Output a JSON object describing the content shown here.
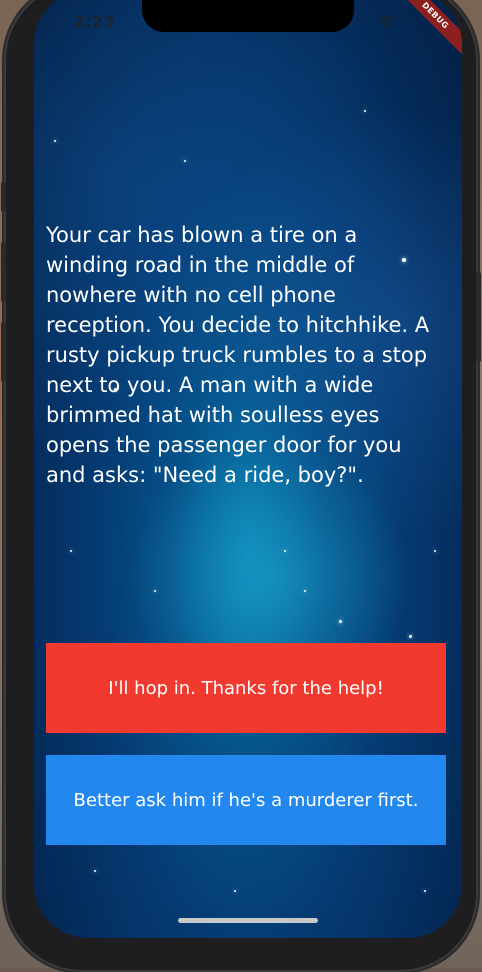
{
  "status_bar": {
    "time": "2:23",
    "wifi_icon": "wifi-icon",
    "debug_label": "DEBUG"
  },
  "story": {
    "text": "Your car has blown a tire on a winding road in the middle of nowhere with no cell phone reception. You decide to hitchhike. A rusty pickup truck rumbles to a stop next to you. A man with a wide brimmed hat with soulless eyes opens the passenger door for you and asks: \"Need a ride, boy?\"."
  },
  "choices": {
    "choice1_label": "I'll hop in. Thanks for the help!",
    "choice2_label": "Better ask him if he's a murderer first."
  },
  "colors": {
    "choice1_bg": "#f2392f",
    "choice2_bg": "#2288ee",
    "debug_banner": "#8e1f1f"
  }
}
